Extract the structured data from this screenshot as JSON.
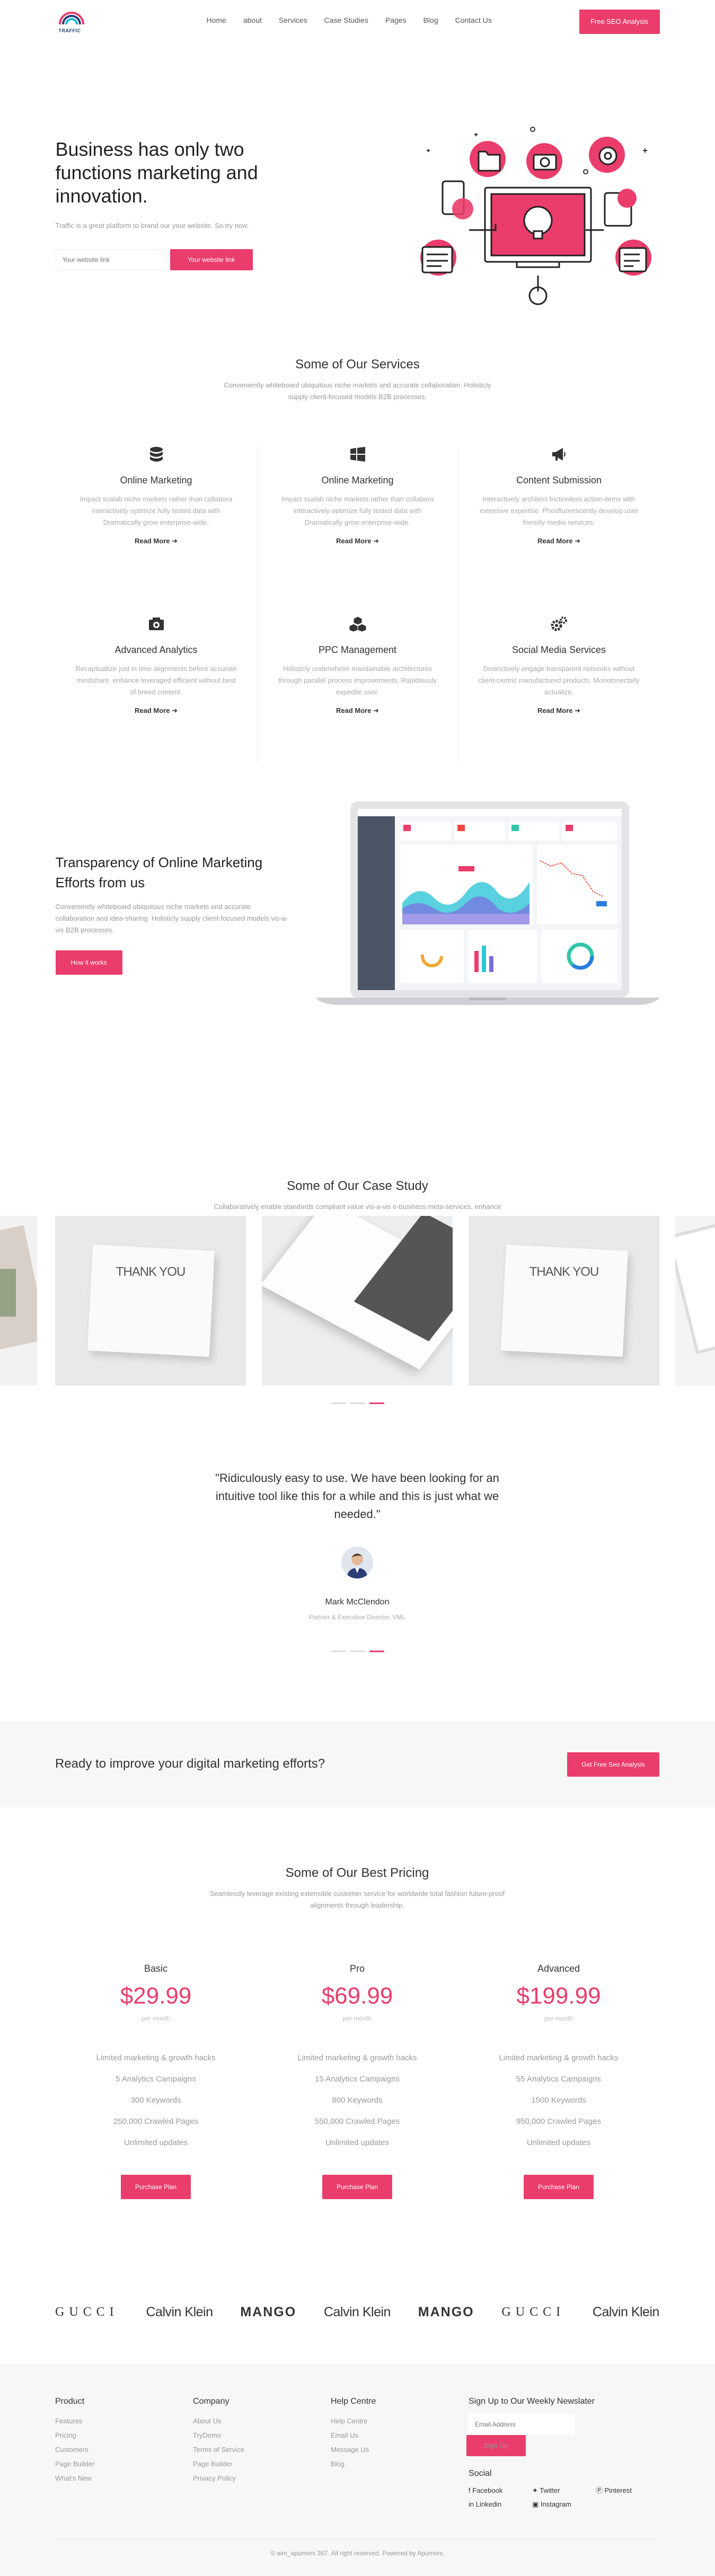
{
  "header": {
    "logo_text": "TRAFFIC",
    "nav": [
      "Home",
      "about",
      "Services",
      "Case Studies",
      "Pages",
      "Blog",
      "Contact Us"
    ],
    "cta": "Free SEO Analysis"
  },
  "hero": {
    "title": "Business has only two functions marketing and innovation.",
    "subtitle": "Traffic is a great platform to brand our your website. So try now.",
    "input_placeholder": "Your website link",
    "button": "Your website link"
  },
  "services": {
    "title": "Some of Our Services",
    "subtitle": "Conveniently whiteboard ubiquitous niche markets and accurate collaboration. Holisticly supply client-focused models B2B processes.",
    "items": [
      {
        "icon": "database-icon",
        "title": "Online Marketing",
        "text": "Impact scalab niche markets rather than collabora interactively optimize fully tested data with Dramatically grow enterprise-wide.",
        "more": "Read More"
      },
      {
        "icon": "windows-icon",
        "title": "Online Marketing",
        "text": "Impact scalab niche markets rather than collabora interactively optimize fully tested data with Dramatically grow enterprise-wide.",
        "more": "Read More"
      },
      {
        "icon": "megaphone-icon",
        "title": "Content Submission",
        "text": "Interactively architect frictionless action-items with extensive expertise. Phosfluorescently develop user friendly media services.",
        "more": "Read More"
      },
      {
        "icon": "camera-icon",
        "title": "Advanced Analytics",
        "text": "Recaptiualize just in time alignments before accurate mindshare. enhance leveraged efficient without best of breed content.",
        "more": "Read More"
      },
      {
        "icon": "cubes-icon",
        "title": "PPC Management",
        "text": "Holisticly underwhelm maintainable architectures through parallel process improvements. Rapidiously expedite user.",
        "more": "Read More"
      },
      {
        "icon": "gears-icon",
        "title": "Social Media Services",
        "text": "Distinctively engage transparent networks without client-centric manufactured products. Monotonectally actualize.",
        "more": "Read More"
      }
    ]
  },
  "transparency": {
    "title": "Transparency of Online Marketing Efforts from us",
    "text": "Conveniently whiteboard ubiquitous niche markets and accurate collaboration and idea-sharing. Holisticly supply client-focused models vis-a-vis B2B processes.",
    "button": "How it works"
  },
  "cases": {
    "title": "Some of Our Case Study",
    "subtitle": "Collaboratively enable standards compliant value vis-a-vis e-business meta-services, enhance end-to-end niches before integrated web services.",
    "card_text": "THANK YOU"
  },
  "testimonial": {
    "quote": "\"Ridiculously easy to use. We have been looking for an intuitive tool like this for a while and this is just what we needed.\"",
    "name": "Mark McClendon",
    "role": "Partner & Executive Director, VML"
  },
  "cta_band": {
    "text": "Ready to improve your digital marketing efforts?",
    "button": "Get Free Seo Analysis"
  },
  "pricing": {
    "title": "Some of Our Best Pricing",
    "subtitle": "Seamlessly leverage existing extensible customer service for worldwide total fashion future-proof alignments through leadership.",
    "plans": [
      {
        "name": "Basic",
        "price": "$29.99",
        "per": "per month",
        "features": [
          "Limited marketing & growth hacks",
          "5 Analytics Campaigns",
          "300 Keywords",
          "250,000 Crawled Pages",
          "Unlimited updates"
        ],
        "button": "Purchase Plan"
      },
      {
        "name": "Pro",
        "price": "$69.99",
        "per": "per month",
        "features": [
          "Limited marketing & growth hacks",
          "15 Analytics Campaigns",
          "800 Keywords",
          "550,000 Crawled Pages",
          "Unlimited updates"
        ],
        "button": "Purchase Plan"
      },
      {
        "name": "Advanced",
        "price": "$199.99",
        "per": "per month",
        "features": [
          "Limited marketing & growth hacks",
          "55 Analytics Campaigns",
          "1500 Keywords",
          "950,000 Crawled Pages",
          "Unlimited updates"
        ],
        "button": "Purchase Plan"
      }
    ]
  },
  "brands": [
    "GUCCI",
    "Calvin Klein",
    "MANGO",
    "Calvin Klein",
    "MANGO",
    "GUCCI",
    "Calvin Klein"
  ],
  "footer": {
    "product": {
      "title": "Product",
      "links": [
        "Features",
        "Pricing",
        "Customers",
        "Page Builder",
        "What's New"
      ]
    },
    "company": {
      "title": "Company",
      "links": [
        "About Us",
        "TryDemo",
        "Terms of Service",
        "Page Builder",
        "Privacy Policy"
      ]
    },
    "help": {
      "title": "Help Centre",
      "links": [
        "Help Centre",
        "Email Us",
        "Message Us",
        "Blog"
      ]
    },
    "newsletter": {
      "title": "Sign Up to Our Weekly Newslater",
      "placeholder": "Email Address",
      "button": "Sign Up"
    },
    "social": {
      "title": "Social",
      "links": [
        "Facebook",
        "Twitter",
        "Pinterest",
        "Linkedin",
        "Instagram"
      ]
    },
    "copyright": "© aim_apumors 367. All right reserved. Powered by Apumors."
  },
  "colors": {
    "accent": "#ea3d6b",
    "navy": "#2a3e75"
  }
}
